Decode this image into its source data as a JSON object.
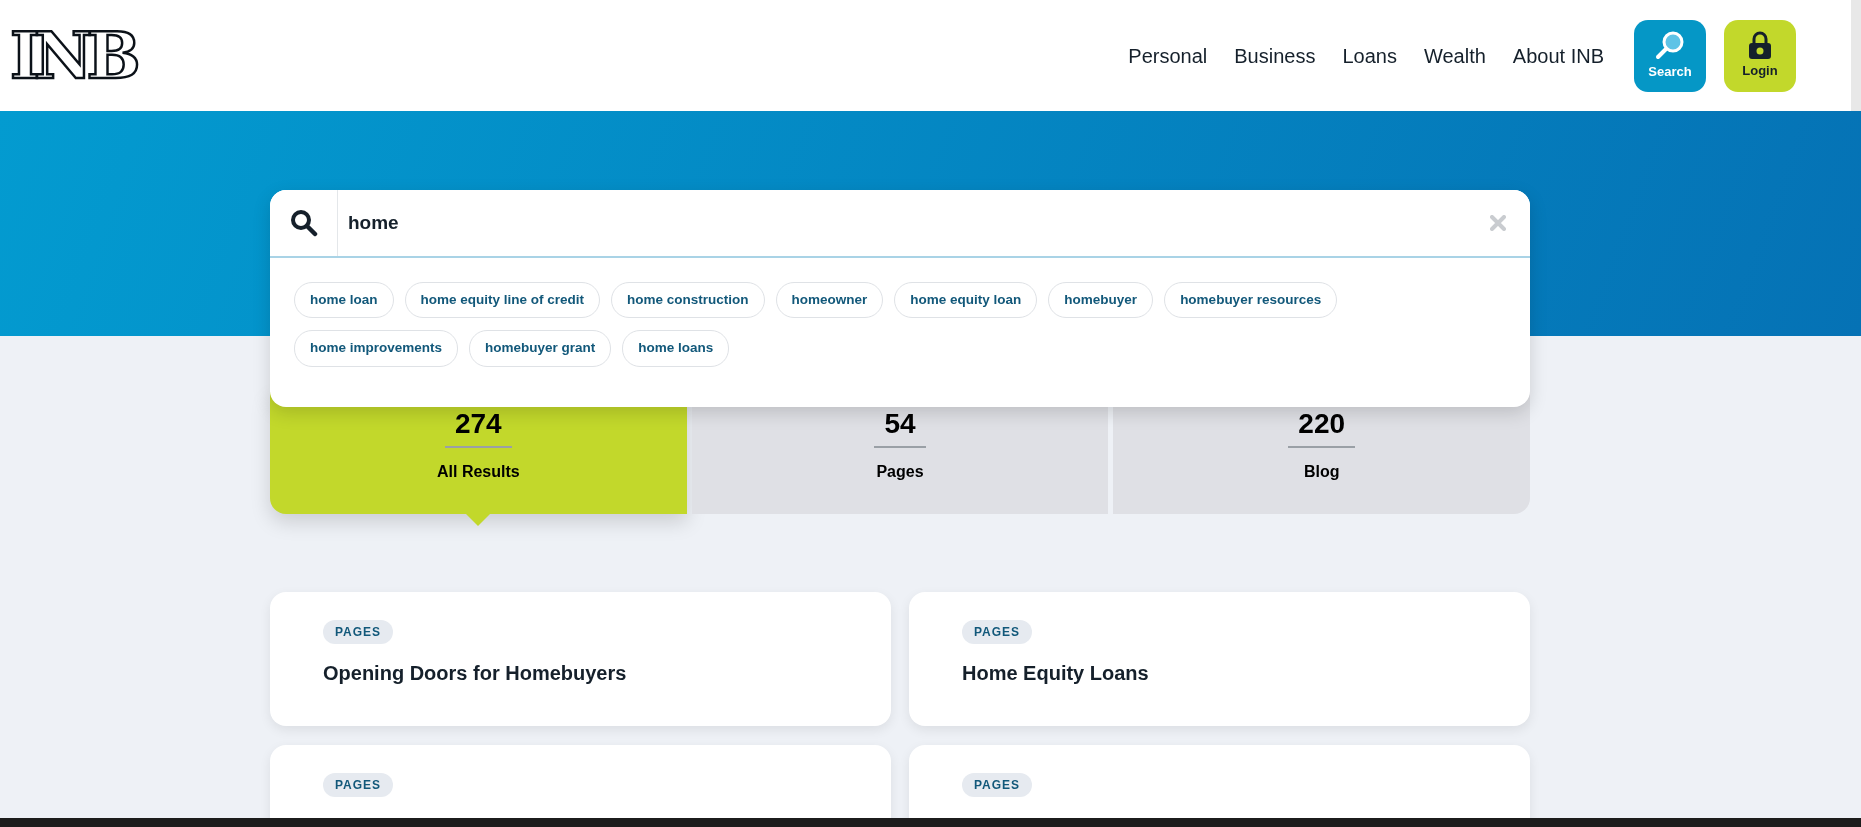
{
  "header": {
    "logo": "INB",
    "nav": [
      "Personal",
      "Business",
      "Loans",
      "Wealth",
      "About INB"
    ],
    "search_button": "Search",
    "login_button": "Login"
  },
  "search": {
    "value": "home",
    "suggestions": [
      "home loan",
      "home equity line of credit",
      "home construction",
      "homeowner",
      "home equity loan",
      "homebuyer",
      "homebuyer resources",
      "home improvements",
      "homebuyer grant",
      "home loans"
    ]
  },
  "tabs": [
    {
      "count": "274",
      "label": "All Results",
      "selected": true
    },
    {
      "count": "54",
      "label": "Pages",
      "selected": false
    },
    {
      "count": "220",
      "label": "Blog",
      "selected": false
    }
  ],
  "results": [
    {
      "tag": "PAGES",
      "title": "Opening Doors for Homebuyers"
    },
    {
      "tag": "PAGES",
      "title": "Home Equity Loans"
    },
    {
      "tag": "PAGES"
    },
    {
      "tag": "PAGES"
    }
  ]
}
